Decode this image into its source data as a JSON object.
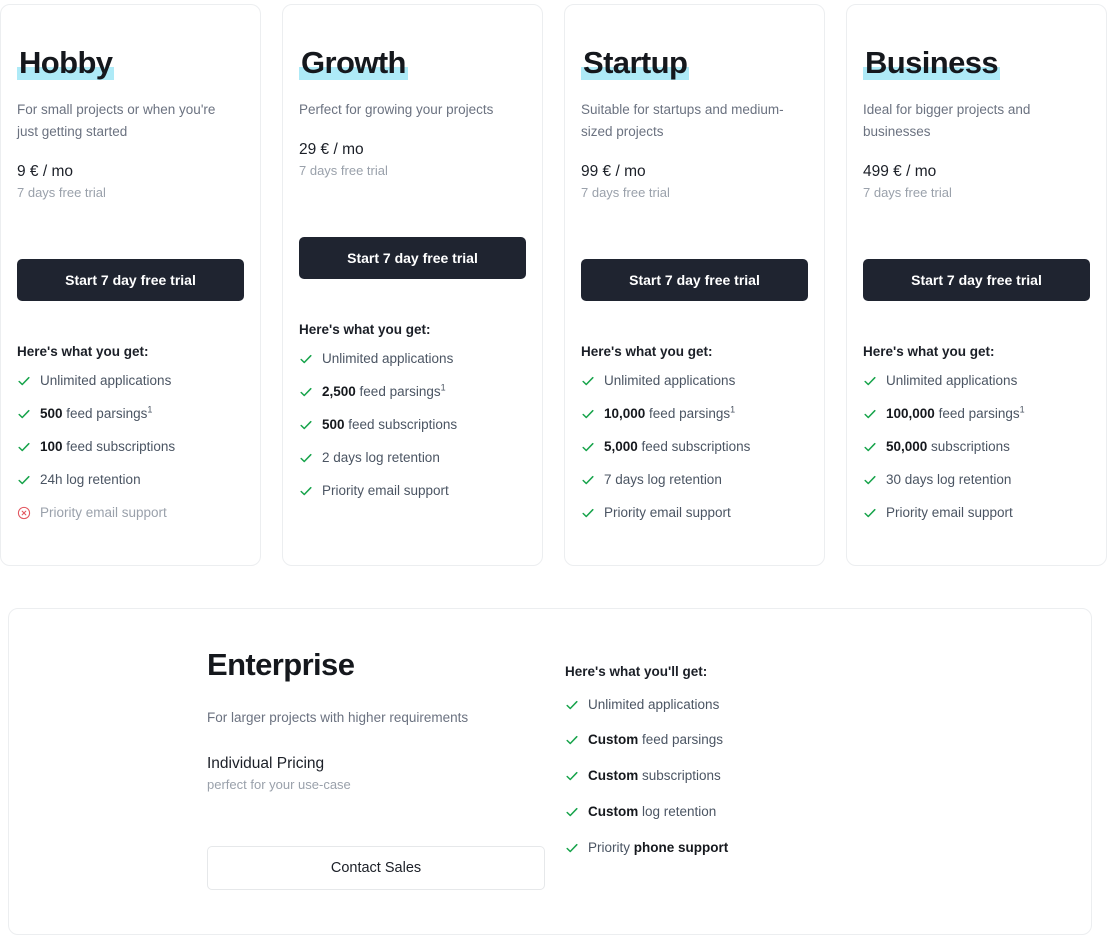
{
  "colors": {
    "highlight": "#aeeaf7",
    "cta_dark_bg": "#1f2430",
    "check_green": "#16a34a",
    "cross_red": "#e2555e",
    "card_border": "#eceef0"
  },
  "plans": [
    {
      "name": "Hobby",
      "description": "For small projects or when you're just getting started",
      "price": "9 € / mo",
      "trial": "7 days free trial",
      "cta": "Start 7 day free trial",
      "features_heading": "Here's what you get:",
      "features": [
        {
          "strong": "",
          "text": "Unlimited applications",
          "suffix_strong": "",
          "footnote": "",
          "included": true
        },
        {
          "strong": "500",
          "text": " feed parsings",
          "suffix_strong": "",
          "footnote": "1",
          "included": true
        },
        {
          "strong": "100",
          "text": " feed subscriptions",
          "suffix_strong": "",
          "footnote": "",
          "included": true
        },
        {
          "strong": "",
          "text": "24h log retention",
          "suffix_strong": "",
          "footnote": "",
          "included": true
        },
        {
          "strong": "",
          "text": "Priority email support",
          "suffix_strong": "",
          "footnote": "",
          "included": false
        }
      ]
    },
    {
      "name": "Growth",
      "description": "Perfect for growing your projects",
      "price": "29 € / mo",
      "trial": "7 days free trial",
      "cta": "Start 7 day free trial",
      "features_heading": "Here's what you get:",
      "features": [
        {
          "strong": "",
          "text": "Unlimited applications",
          "suffix_strong": "",
          "footnote": "",
          "included": true
        },
        {
          "strong": "2,500",
          "text": " feed parsings",
          "suffix_strong": "",
          "footnote": "1",
          "included": true
        },
        {
          "strong": "500",
          "text": " feed subscriptions",
          "suffix_strong": "",
          "footnote": "",
          "included": true
        },
        {
          "strong": "",
          "text": "2 days log retention",
          "suffix_strong": "",
          "footnote": "",
          "included": true
        },
        {
          "strong": "",
          "text": "Priority email support",
          "suffix_strong": "",
          "footnote": "",
          "included": true
        }
      ]
    },
    {
      "name": "Startup",
      "description": "Suitable for startups and medium-sized projects",
      "price": "99 € / mo",
      "trial": "7 days free trial",
      "cta": "Start 7 day free trial",
      "features_heading": "Here's what you get:",
      "features": [
        {
          "strong": "",
          "text": "Unlimited applications",
          "suffix_strong": "",
          "footnote": "",
          "included": true
        },
        {
          "strong": "10,000",
          "text": " feed parsings",
          "suffix_strong": "",
          "footnote": "1",
          "included": true
        },
        {
          "strong": "5,000",
          "text": " feed subscriptions",
          "suffix_strong": "",
          "footnote": "",
          "included": true
        },
        {
          "strong": "",
          "text": "7 days log retention",
          "suffix_strong": "",
          "footnote": "",
          "included": true
        },
        {
          "strong": "",
          "text": "Priority email support",
          "suffix_strong": "",
          "footnote": "",
          "included": true
        }
      ]
    },
    {
      "name": "Business",
      "description": "Ideal for bigger projects and businesses",
      "price": "499 € / mo",
      "trial": "7 days free trial",
      "cta": "Start 7 day free trial",
      "features_heading": "Here's what you get:",
      "features": [
        {
          "strong": "",
          "text": "Unlimited applications",
          "suffix_strong": "",
          "footnote": "",
          "included": true
        },
        {
          "strong": "100,000",
          "text": " feed parsings",
          "suffix_strong": "",
          "footnote": "1",
          "included": true
        },
        {
          "strong": "50,000",
          "text": " subscriptions",
          "suffix_strong": "",
          "footnote": "",
          "included": true
        },
        {
          "strong": "",
          "text": "30 days log retention",
          "suffix_strong": "",
          "footnote": "",
          "included": true
        },
        {
          "strong": "",
          "text": "Priority email support",
          "suffix_strong": "",
          "footnote": "",
          "included": true
        }
      ]
    }
  ],
  "enterprise": {
    "name": "Enterprise",
    "description": "For larger projects with higher requirements",
    "price": "Individual Pricing",
    "sub": "perfect for your use-case",
    "cta": "Contact Sales",
    "features_heading": "Here's what you'll get:",
    "features": [
      {
        "strong": "",
        "text": "Unlimited applications",
        "suffix_strong": "",
        "footnote": "",
        "included": true
      },
      {
        "strong": "Custom",
        "text": " feed parsings",
        "suffix_strong": "",
        "footnote": "",
        "included": true
      },
      {
        "strong": "Custom",
        "text": " subscriptions",
        "suffix_strong": "",
        "footnote": "",
        "included": true
      },
      {
        "strong": "Custom",
        "text": " log retention",
        "suffix_strong": "",
        "footnote": "",
        "included": true
      },
      {
        "strong": "",
        "text": "Priority ",
        "suffix_strong": "phone support",
        "footnote": "",
        "included": true
      }
    ]
  }
}
